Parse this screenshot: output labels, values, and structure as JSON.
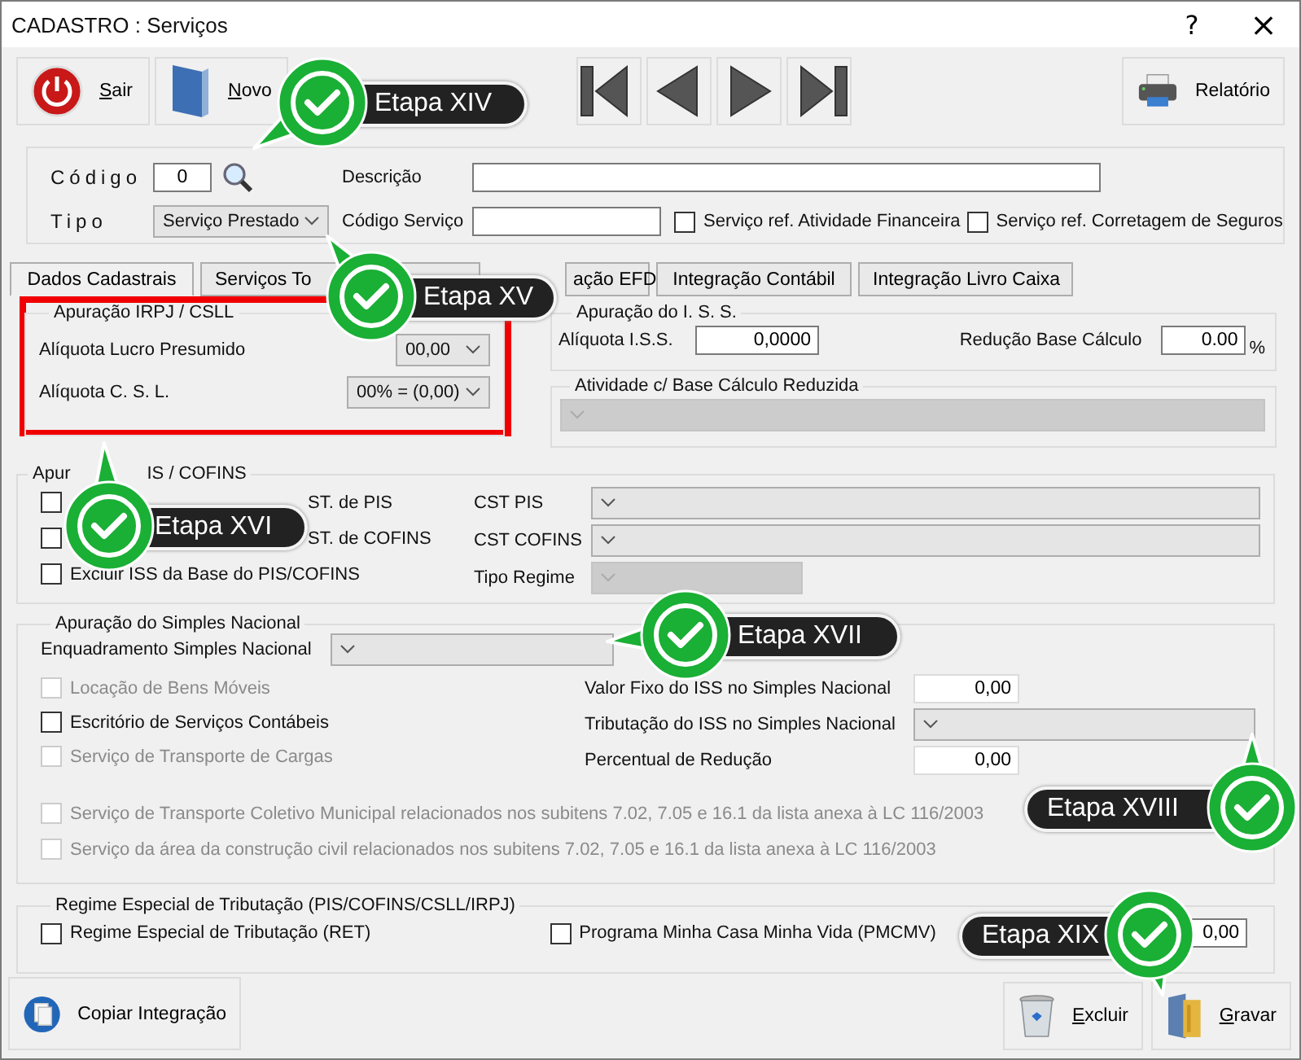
{
  "window": {
    "title": "CADASTRO : Serviços",
    "help": "?",
    "close": "×"
  },
  "toolbar": {
    "left": [
      {
        "label": "Sair",
        "kind": "power"
      },
      {
        "label": "Novo",
        "kind": "book"
      }
    ],
    "nav": [
      {
        "kind": "first"
      },
      {
        "kind": "prev"
      },
      {
        "kind": "next"
      },
      {
        "kind": "last"
      }
    ],
    "right": {
      "label": "Relatório",
      "kind": "printer"
    }
  },
  "header": {
    "codigo": {
      "label": "Código",
      "value": "0"
    },
    "descricao": {
      "label": "Descrição"
    },
    "tipo": {
      "label": "Tipo",
      "value": "Serviço Prestado"
    },
    "codigo_servico": {
      "label": "Código Serviço"
    },
    "checks": [
      {
        "label": "Serviço ref. Atividade Financeira",
        "checked": false
      },
      {
        "label": "Serviço ref. Corretagem de Seguros",
        "checked": false
      }
    ]
  },
  "tabs": [
    {
      "label": "Dados Cadastrais",
      "selected": true
    },
    {
      "label": "Serviços To",
      "selected": false
    },
    {
      "label": "ação EFD",
      "selected": false
    },
    {
      "label": "Integração Contábil",
      "selected": false
    },
    {
      "label": "Integração Livro Caixa",
      "selected": false
    }
  ],
  "irpj": {
    "title": "Apuração IRPJ / CSLL",
    "highlighted": true,
    "fields": [
      {
        "label": "Alíquota Lucro Presumido",
        "value": "00,00"
      },
      {
        "label": "Alíquota C. S. L.",
        "value": "00% = (0,00)"
      }
    ]
  },
  "iss": {
    "title": "Apuração do I. S. S.",
    "aliquota": {
      "label": "Alíquota  I.S.S.",
      "value": "0,0000"
    },
    "reducao": {
      "label": "Redução Base Cálculo",
      "value": "0.00",
      "unit": "%"
    }
  },
  "atividade": {
    "title": "Atividade c/ Base Cálculo Reduzida",
    "disabled": true
  },
  "pis": {
    "title_parts": [
      "Apur",
      "IS / COFINS"
    ],
    "checks": [
      {
        "label": "ST. de PIS",
        "checked": false
      },
      {
        "label": "ST. de COFINS",
        "checked": false
      },
      {
        "label": "Excluir ISS da Base do PIS/COFINS",
        "checked": false
      }
    ],
    "selects": [
      {
        "label": "CST PIS",
        "disabled": false
      },
      {
        "label": "CST COFINS",
        "disabled": false
      },
      {
        "label": "Tipo Regime",
        "disabled": true
      }
    ]
  },
  "simples": {
    "title": "Apuração do Simples Nacional",
    "enquadramento": {
      "label": "Enquadramento Simples Nacional"
    },
    "checks": [
      {
        "label": "Locação de Bens Móveis",
        "checked": false,
        "disabled": true
      },
      {
        "label": "Escritório de Serviços Contábeis",
        "checked": false,
        "disabled": false
      },
      {
        "label": "Serviço de Transporte de Cargas",
        "checked": false,
        "disabled": true
      }
    ],
    "right": [
      {
        "label": "Valor Fixo do ISS no Simples Nacional",
        "kind": "input",
        "value": "0,00"
      },
      {
        "label": "Tributação do ISS no Simples Nacional",
        "kind": "select"
      },
      {
        "label": "Percentual de Redução",
        "kind": "input",
        "value": "0,00"
      }
    ],
    "long_checks": [
      {
        "label": "Serviço de Transporte Coletivo Municipal relacionados nos subitens 7.02, 7.05 e 16.1 da lista anexa à LC 116/2003",
        "checked": false,
        "disabled": true
      },
      {
        "label": "Serviço da área da construção civil relacionados nos subitens 7.02, 7.05 e 16.1 da lista anexa à LC 116/2003",
        "checked": false,
        "disabled": true
      }
    ]
  },
  "regime": {
    "title": "Regime Especial de Tributação (PIS/COFINS/CSLL/IRPJ)",
    "checks": [
      {
        "label": "Regime Especial de Tributação (RET)",
        "checked": false
      },
      {
        "label": "Programa Minha Casa Minha Vida (PMCMV)",
        "checked": false
      }
    ],
    "aliquota_value": "0,00"
  },
  "bottom": {
    "left": {
      "label": "Copiar Integração",
      "kind": "copy"
    },
    "right": [
      {
        "label": "Excluir",
        "kind": "trash"
      },
      {
        "label": "Gravar",
        "kind": "folder"
      }
    ]
  },
  "callouts": [
    {
      "label": "Etapa XIV"
    },
    {
      "label": "Etapa XV"
    },
    {
      "label": "Etapa XVI"
    },
    {
      "label": "Etapa XVII"
    },
    {
      "label": "Etapa XVIII"
    },
    {
      "label": "Etapa XIX"
    }
  ]
}
